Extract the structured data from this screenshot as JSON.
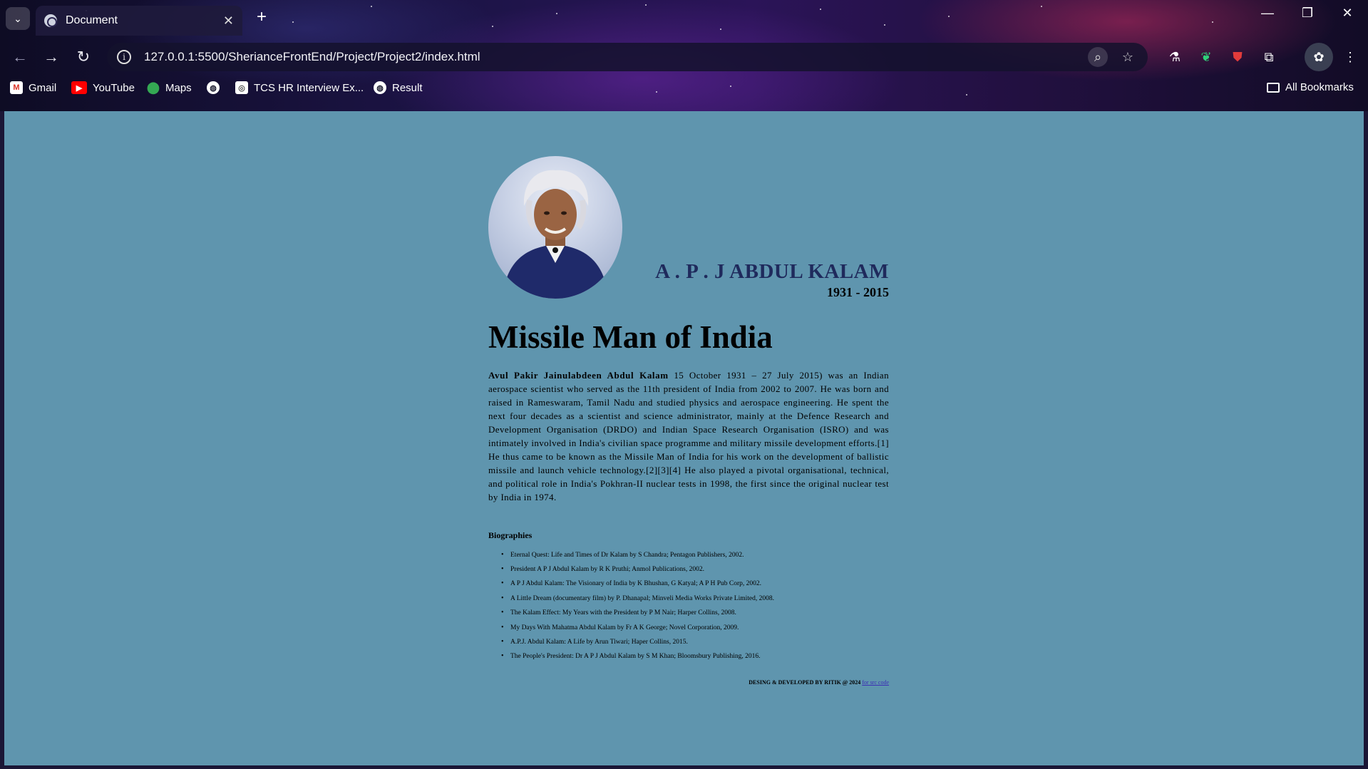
{
  "browser": {
    "tab_title": "Document",
    "url": "127.0.0.1:5500/SherianceFrontEnd/Project/Project2/index.html",
    "bookmarks": [
      {
        "label": "Gmail",
        "icon": "gmail-icon"
      },
      {
        "label": "YouTube",
        "icon": "youtube-icon"
      },
      {
        "label": "Maps",
        "icon": "maps-icon"
      },
      {
        "label": "",
        "icon": "globe-icon"
      },
      {
        "label": "TCS HR Interview Ex...",
        "icon": "tcs-icon"
      },
      {
        "label": "Result",
        "icon": "globe-icon"
      }
    ],
    "all_bookmarks": "All Bookmarks"
  },
  "page": {
    "name": "A . P . J ABDUL KALAM",
    "years": "1931 - 2015",
    "headline": "Missile Man of India",
    "bio_name": "Avul Pakir Jainulabdeen Abdul Kalam",
    "bio_text": " 15 October 1931 – 27 July 2015) was an Indian aerospace scientist who served as the 11th president of India from 2002 to 2007. He was born and raised in Rameswaram, Tamil Nadu and studied physics and aerospace engineering. He spent the next four decades as a scientist and science administrator, mainly at the Defence Research and Development Organisation (DRDO) and Indian Space Research Organisation (ISRO) and was intimately involved in India's civilian space programme and military missile development efforts.[1] He thus came to be known as the Missile Man of India for his work on the development of ballistic missile and launch vehicle technology.[2][3][4] He also played a pivotal organisational, technical, and political role in India's Pokhran-II nuclear tests in 1998, the first since the original nuclear test by India in 1974.",
    "biographies_heading": "Biographies",
    "biographies": [
      "Eternal Quest: Life and Times of Dr Kalam by S Chandra; Pentagon Publishers, 2002.",
      "President A P J Abdul Kalam by R K Pruthi; Anmol Publications, 2002.",
      "A P J Abdul Kalam: The Visionary of India by K Bhushan, G Katyal; A P H Pub Corp, 2002.",
      "A Little Dream (documentary film) by P. Dhanapal; Minveli Media Works Private Limited, 2008.",
      "The Kalam Effect: My Years with the President by P M Nair; Harper Collins, 2008.",
      "My Days With Mahatma Abdul Kalam by Fr A K George; Novel Corporation, 2009.",
      "A.P.J. Abdul Kalam: A Life by Arun Tiwari; Haper Collins, 2015.",
      "The People's President: Dr A P J Abdul Kalam by S M Khan; Bloomsbury Publishing, 2016."
    ],
    "footer_text": "DESING & DEVELOPED BY RITIK @ 2024",
    "footer_link": "for src code"
  },
  "colors": {
    "page_background": "#5f95ae",
    "name_color": "#1f2a5c",
    "link_color": "#3c2fb5"
  }
}
